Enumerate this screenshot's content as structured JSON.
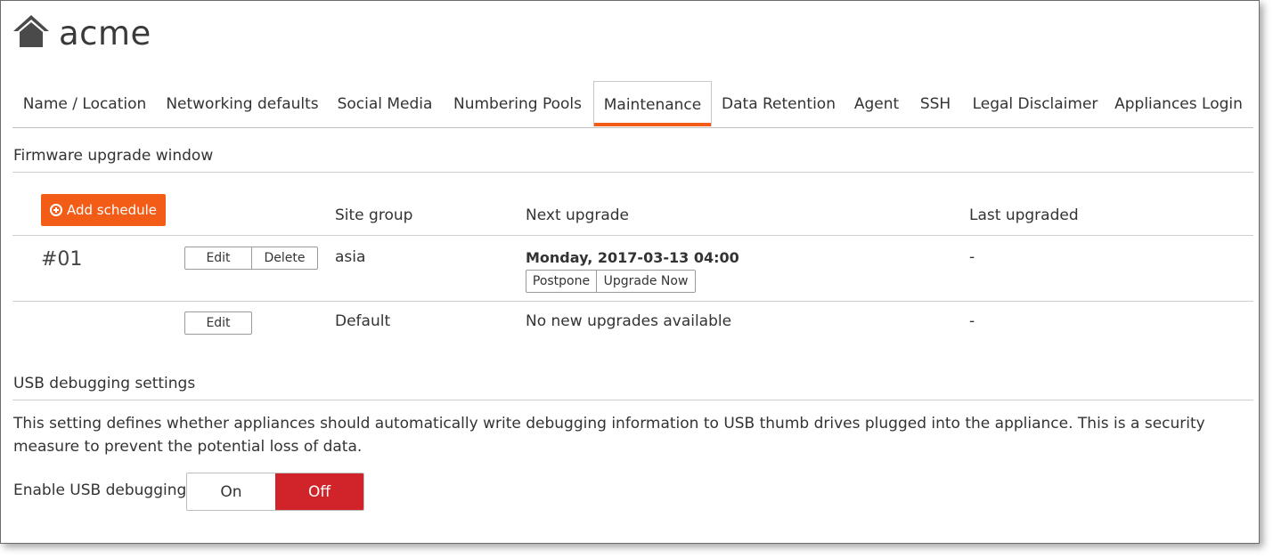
{
  "org": {
    "name": "acme",
    "icon": "home-icon"
  },
  "tabs": [
    {
      "label": "Name / Location"
    },
    {
      "label": "Networking defaults"
    },
    {
      "label": "Social Media"
    },
    {
      "label": "Numbering Pools"
    },
    {
      "label": "Maintenance",
      "active": true
    },
    {
      "label": "Data Retention"
    },
    {
      "label": "Agent"
    },
    {
      "label": "SSH"
    },
    {
      "label": "Legal Disclaimer"
    },
    {
      "label": "Appliances Login"
    }
  ],
  "firmware": {
    "section_title": "Firmware upgrade window",
    "add_label": "Add schedule",
    "columns": {
      "site_group": "Site group",
      "next_upgrade": "Next upgrade",
      "last_upgraded": "Last upgraded"
    },
    "rows": [
      {
        "id": "#01",
        "edit": "Edit",
        "delete": "Delete",
        "site_group": "asia",
        "next_upgrade": "Monday, 2017-03-13 04:00",
        "postpone": "Postpone",
        "upgrade_now": "Upgrade Now",
        "last_upgraded": "-"
      },
      {
        "edit": "Edit",
        "site_group": "Default",
        "next_upgrade": "No new upgrades available",
        "last_upgraded": "-"
      }
    ]
  },
  "usb": {
    "section_title": "USB debugging settings",
    "description": "This setting defines whether appliances should automatically write debugging information to USB thumb drives plugged into the appliance. This is a security measure to prevent the potential loss of data.",
    "toggle_label": "Enable USB debugging",
    "on_label": "On",
    "off_label": "Off",
    "selected": "Off"
  },
  "colors": {
    "accent": "#f25c17",
    "off_active": "#d0232a"
  }
}
